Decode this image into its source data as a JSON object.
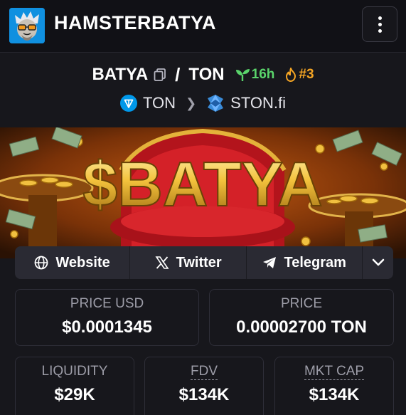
{
  "header": {
    "title": "HAMSTERBATYA"
  },
  "pair": {
    "base": "BATYA",
    "separator": "/",
    "quote": "TON",
    "age": "16h",
    "rank": "#3"
  },
  "chain": {
    "network": "TON",
    "dex": "STON.fi"
  },
  "banner": {
    "text": "$BATYA"
  },
  "links": {
    "website": "Website",
    "twitter": "Twitter",
    "telegram": "Telegram"
  },
  "stats": {
    "price_usd_label": "PRICE USD",
    "price_usd_value": "$0.0001345",
    "price_label": "PRICE",
    "price_value": "0.00002700 TON",
    "liquidity_label": "LIQUIDITY",
    "liquidity_value": "$29K",
    "fdv_label": "FDV",
    "fdv_value": "$134K",
    "mktcap_label": "MKT CAP",
    "mktcap_value": "$134K"
  },
  "colors": {
    "background": "#17171c",
    "accent_green": "#5ad46b",
    "accent_orange": "#f5a524",
    "ton_blue": "#0098ea",
    "ston_blue": "#3a8bd8"
  }
}
